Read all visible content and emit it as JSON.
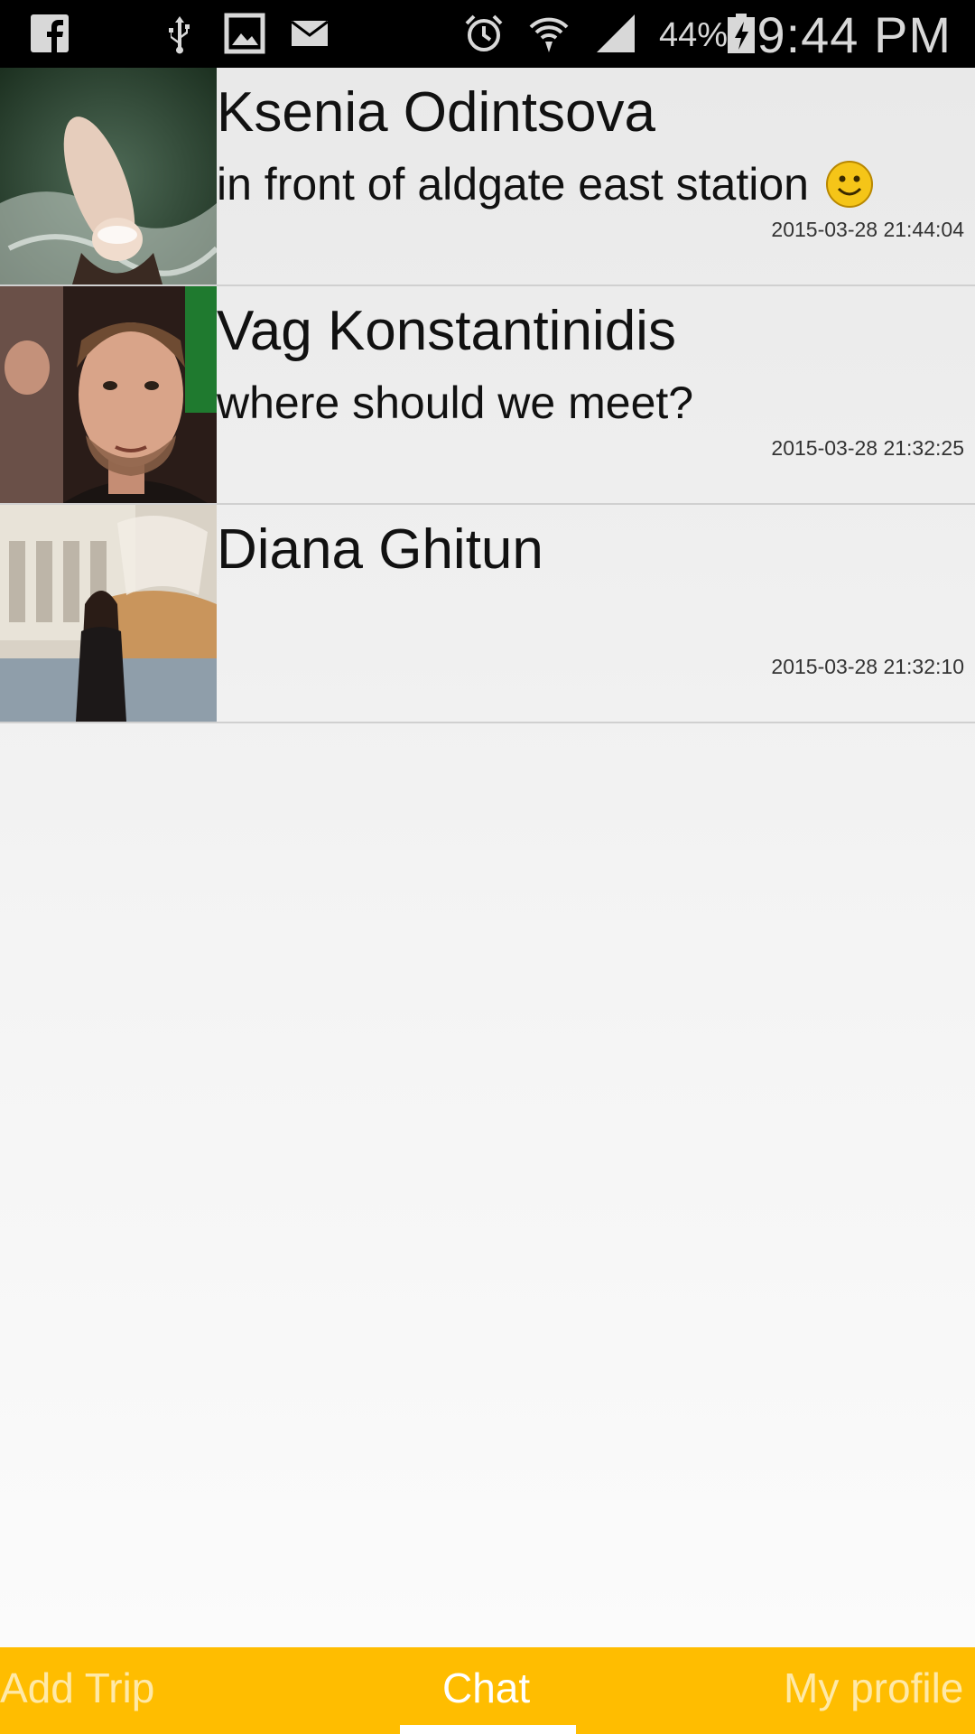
{
  "status_bar": {
    "battery_percent": "44%",
    "time": "9:44 PM",
    "icons": [
      "facebook-icon",
      "usb-icon",
      "gallery-icon",
      "mail-icon",
      "alarm-icon",
      "wifi-icon",
      "signal-icon",
      "battery-icon"
    ]
  },
  "chats": [
    {
      "name": "Ksenia Odintsova",
      "message": "in front of aldgate east station",
      "emoji": "smiley-icon",
      "timestamp": "2015-03-28 21:44:04"
    },
    {
      "name": "Vag Konstantinidis",
      "message": "where should we meet?",
      "timestamp": "2015-03-28 21:32:25"
    },
    {
      "name": "Diana Ghitun",
      "message": "",
      "timestamp": "2015-03-28 21:32:10"
    }
  ],
  "nav": {
    "tabs": [
      {
        "label": "Add Trip"
      },
      {
        "label": "Chat",
        "active": true
      },
      {
        "label": "My profile"
      }
    ]
  },
  "colors": {
    "accent": "#ffbd00",
    "status_bar": "#000000",
    "inactive_tab_text": "#ffe9a8",
    "active_tab_text": "#ffffff"
  }
}
